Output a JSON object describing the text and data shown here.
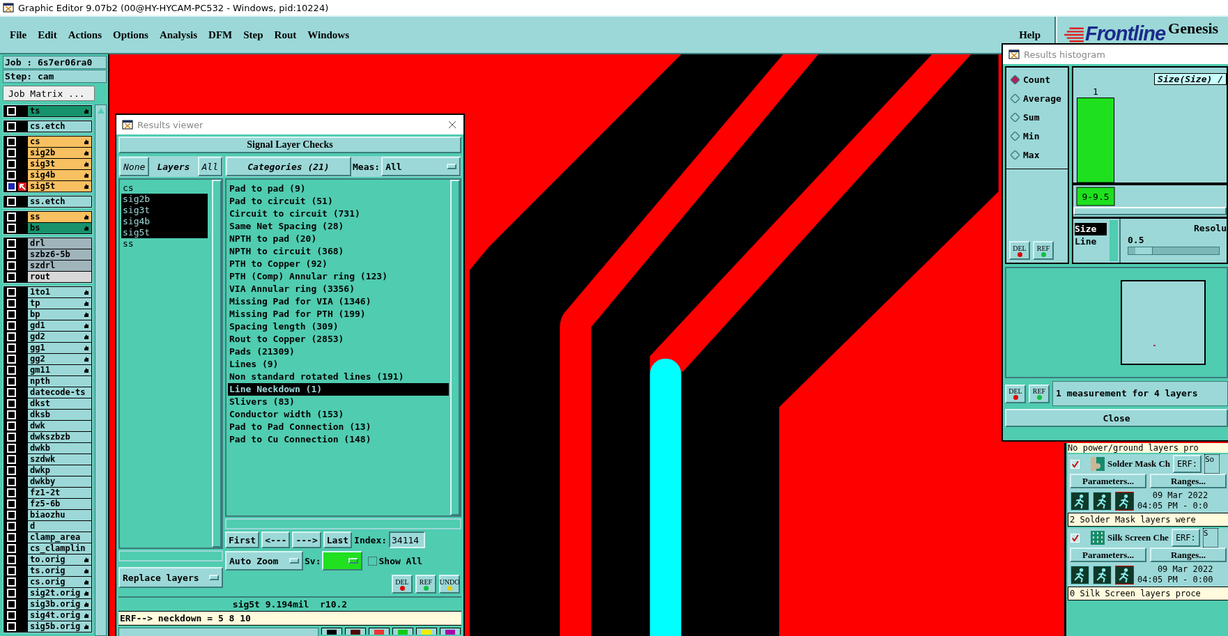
{
  "window": {
    "title": "Graphic Editor 9.07b2 (00@HY-HYCAM-PC532 - Windows, pid:10224)"
  },
  "menu": [
    "File",
    "Edit",
    "Actions",
    "Options",
    "Analysis",
    "DFM",
    "Step",
    "Rout",
    "Windows"
  ],
  "help": "Help",
  "logo": {
    "brand": "Frontline",
    "product": "Genesis"
  },
  "job": "Job : 6s7er06ra0",
  "step": "Step: cam",
  "job_matrix_button": "Job Matrix ...",
  "layer_groups": [
    [
      {
        "name": "ts",
        "color": "#17936c",
        "hand": true,
        "checked": false,
        "selected": false
      }
    ],
    [
      {
        "name": "cs.etch",
        "color": "#9cd8d8",
        "hand": false,
        "checked": false,
        "selected": false
      }
    ],
    [
      {
        "name": "cs",
        "color": "#f8c060",
        "hand": true,
        "checked": false,
        "selected": false
      },
      {
        "name": "sig2b",
        "color": "#f8c060",
        "hand": true,
        "checked": false,
        "selected": false
      },
      {
        "name": "sig3t",
        "color": "#f8c060",
        "hand": true,
        "checked": false,
        "selected": false
      },
      {
        "name": "sig4b",
        "color": "#f8c060",
        "hand": true,
        "checked": false,
        "selected": false
      },
      {
        "name": "sig5t",
        "color": "#f8c060",
        "hand": true,
        "checked": false,
        "selected": true
      }
    ],
    [
      {
        "name": "ss.etch",
        "color": "#9cd8d8",
        "hand": false,
        "checked": false,
        "selected": false
      }
    ],
    [
      {
        "name": "ss",
        "color": "#f8c060",
        "hand": true,
        "checked": false,
        "selected": false
      },
      {
        "name": "bs",
        "color": "#17936c",
        "hand": true,
        "checked": false,
        "selected": false
      }
    ],
    [
      {
        "name": "drl",
        "color": "#a0b4bc",
        "hand": false,
        "checked": false,
        "selected": false
      },
      {
        "name": "szbz6-5b",
        "color": "#a0b4bc",
        "hand": false,
        "checked": false,
        "selected": false
      },
      {
        "name": "szdrl",
        "color": "#a0b4bc",
        "hand": false,
        "checked": false,
        "selected": false
      },
      {
        "name": "rout",
        "color": "#d8d8d8",
        "hand": false,
        "checked": false,
        "selected": false
      }
    ],
    [
      {
        "name": "1to1",
        "color": "#9cd8d8",
        "hand": true,
        "checked": false,
        "selected": false
      },
      {
        "name": "tp",
        "color": "#9cd8d8",
        "hand": true,
        "checked": false,
        "selected": false
      },
      {
        "name": "bp",
        "color": "#9cd8d8",
        "hand": true,
        "checked": false,
        "selected": false
      },
      {
        "name": "gd1",
        "color": "#9cd8d8",
        "hand": true,
        "checked": false,
        "selected": false
      },
      {
        "name": "gd2",
        "color": "#9cd8d8",
        "hand": true,
        "checked": false,
        "selected": false
      },
      {
        "name": "gg1",
        "color": "#9cd8d8",
        "hand": true,
        "checked": false,
        "selected": false
      },
      {
        "name": "gg2",
        "color": "#9cd8d8",
        "hand": true,
        "checked": false,
        "selected": false
      },
      {
        "name": "gm11",
        "color": "#9cd8d8",
        "hand": true,
        "checked": false,
        "selected": false
      },
      {
        "name": "npth",
        "color": "#9cd8d8",
        "hand": false,
        "checked": false,
        "selected": false
      },
      {
        "name": "datecode-ts",
        "color": "#9cd8d8",
        "hand": false,
        "checked": false,
        "selected": false
      },
      {
        "name": "dkst",
        "color": "#9cd8d8",
        "hand": false,
        "checked": false,
        "selected": false
      },
      {
        "name": "dksb",
        "color": "#9cd8d8",
        "hand": false,
        "checked": false,
        "selected": false
      },
      {
        "name": "dwk",
        "color": "#9cd8d8",
        "hand": false,
        "checked": false,
        "selected": false
      },
      {
        "name": "dwkszbzb",
        "color": "#9cd8d8",
        "hand": false,
        "checked": false,
        "selected": false
      },
      {
        "name": "dwkb",
        "color": "#9cd8d8",
        "hand": false,
        "checked": false,
        "selected": false
      },
      {
        "name": "szdwk",
        "color": "#9cd8d8",
        "hand": false,
        "checked": false,
        "selected": false
      },
      {
        "name": "dwkp",
        "color": "#9cd8d8",
        "hand": false,
        "checked": false,
        "selected": false
      },
      {
        "name": "dwkby",
        "color": "#9cd8d8",
        "hand": false,
        "checked": false,
        "selected": false
      },
      {
        "name": "fz1-2t",
        "color": "#9cd8d8",
        "hand": false,
        "checked": false,
        "selected": false
      },
      {
        "name": "fz5-6b",
        "color": "#9cd8d8",
        "hand": false,
        "checked": false,
        "selected": false
      },
      {
        "name": "biaozhu",
        "color": "#9cd8d8",
        "hand": false,
        "checked": false,
        "selected": false
      },
      {
        "name": "d",
        "color": "#9cd8d8",
        "hand": false,
        "checked": false,
        "selected": false
      },
      {
        "name": "clamp_area",
        "color": "#9cd8d8",
        "hand": false,
        "checked": false,
        "selected": false
      },
      {
        "name": "cs_clamplin",
        "color": "#9cd8d8",
        "hand": false,
        "checked": false,
        "selected": false
      },
      {
        "name": "to.orig",
        "color": "#9cd8d8",
        "hand": true,
        "checked": false,
        "selected": false
      },
      {
        "name": "ts.orig",
        "color": "#9cd8d8",
        "hand": true,
        "checked": false,
        "selected": false
      },
      {
        "name": "cs.orig",
        "color": "#9cd8d8",
        "hand": true,
        "checked": false,
        "selected": false
      },
      {
        "name": "sig2t.orig",
        "color": "#9cd8d8",
        "hand": true,
        "checked": false,
        "selected": false
      },
      {
        "name": "sig3b.orig",
        "color": "#9cd8d8",
        "hand": true,
        "checked": false,
        "selected": false
      },
      {
        "name": "sig4t.orig",
        "color": "#9cd8d8",
        "hand": true,
        "checked": false,
        "selected": false
      },
      {
        "name": "sig5b.orig",
        "color": "#9cd8d8",
        "hand": true,
        "checked": false,
        "selected": false
      }
    ]
  ],
  "results_viewer": {
    "title": "Results viewer",
    "heading": "Signal Layer Checks",
    "none_button": "None",
    "layers_label": "Layers",
    "all_button": "All",
    "categories_button": "Categories (21)",
    "meas_label": "Meas:",
    "meas_value": "All",
    "layers": [
      {
        "name": "cs",
        "selected": false
      },
      {
        "name": "sig2b",
        "selected": true
      },
      {
        "name": "sig3t",
        "selected": true
      },
      {
        "name": "sig4b",
        "selected": true
      },
      {
        "name": "sig5t",
        "selected": true
      },
      {
        "name": "ss",
        "selected": false
      }
    ],
    "categories": [
      {
        "label": "Pad to pad (9)",
        "selected": false
      },
      {
        "label": "Pad to circuit (51)",
        "selected": false
      },
      {
        "label": "Circuit to circuit (731)",
        "selected": false
      },
      {
        "label": "Same Net Spacing (28)",
        "selected": false
      },
      {
        "label": "NPTH to pad (20)",
        "selected": false
      },
      {
        "label": "NPTH to circuit (368)",
        "selected": false
      },
      {
        "label": "PTH to Copper (92)",
        "selected": false
      },
      {
        "label": "PTH (Comp) Annular ring (123)",
        "selected": false
      },
      {
        "label": "VIA Annular ring (3356)",
        "selected": false
      },
      {
        "label": "Missing Pad for VIA (1346)",
        "selected": false
      },
      {
        "label": "Missing Pad for PTH (199)",
        "selected": false
      },
      {
        "label": "Spacing length (309)",
        "selected": false
      },
      {
        "label": "Rout to Copper (2853)",
        "selected": false
      },
      {
        "label": "Pads (21309)",
        "selected": false
      },
      {
        "label": "Lines (9)",
        "selected": false
      },
      {
        "label": "Non standard rotated lines (191)",
        "selected": false
      },
      {
        "label": "Line Neckdown (1)",
        "selected": true
      },
      {
        "label": "Slivers (83)",
        "selected": false
      },
      {
        "label": "Conductor width (153)",
        "selected": false
      },
      {
        "label": "Pad to Pad Connection (13)",
        "selected": false
      },
      {
        "label": "Pad to Cu Connection (148)",
        "selected": false
      }
    ],
    "nav": [
      "First",
      "<---",
      "--->",
      "Last"
    ],
    "index_label": "Index:",
    "index_value": "34114",
    "zoom_mode": "Auto Zoom",
    "sv_label": "Sv:",
    "show_all": {
      "label": "Show All",
      "checked": false
    },
    "replace_mode": "Replace layers",
    "buttons": [
      "DEL",
      "REF",
      "UNDO"
    ],
    "status": "sig5t 9.194mil  r10.2",
    "erf_line": "ERF--> neckdown = 5 8 10"
  },
  "histogram": {
    "title": "Results histogram",
    "modes": [
      {
        "label": "Count",
        "selected": true
      },
      {
        "label": "Average",
        "selected": false
      },
      {
        "label": "Sum",
        "selected": false
      },
      {
        "label": "Min",
        "selected": false
      },
      {
        "label": "Max",
        "selected": false
      }
    ],
    "plot_title": "Size(Size) /",
    "bins": [
      {
        "range": "9-9.5",
        "count": "1",
        "level": 1
      }
    ],
    "fields": [
      {
        "label": "Size",
        "selected": true
      },
      {
        "label": "Line",
        "selected": false
      }
    ],
    "resolution_label": "Resolu",
    "resolution_value": "0.5",
    "resolution": {
      "level": 0.08
    },
    "buttons": [
      "DEL",
      "REF"
    ],
    "preview_buttons": [
      "DEL",
      "REF"
    ],
    "message": "1 measurement for 4 layers",
    "close_button": "Close"
  },
  "checklist": {
    "top_message": "No power/ground layers pro",
    "items": [
      {
        "checked": true,
        "kind": "mask",
        "name": "Solder Mask Ch",
        "erf_label": "ERF:",
        "erf_value": "So",
        "parameters_button": "Parameters...",
        "ranges_button": "Ranges...",
        "date": "09 Mar 2022",
        "time": "04:05 PM - 0:0",
        "message": "2 Solder Mask layers were"
      },
      {
        "checked": true,
        "kind": "silk",
        "name": "Silk Screen Che",
        "erf_label": "ERF:",
        "erf_value": "S",
        "parameters_button": "Parameters...",
        "ranges_button": "Ranges...",
        "date": "09 Mar 2022",
        "time": "04:05 PM - 0:00",
        "message": "0 Silk Screen layers proce"
      }
    ]
  }
}
